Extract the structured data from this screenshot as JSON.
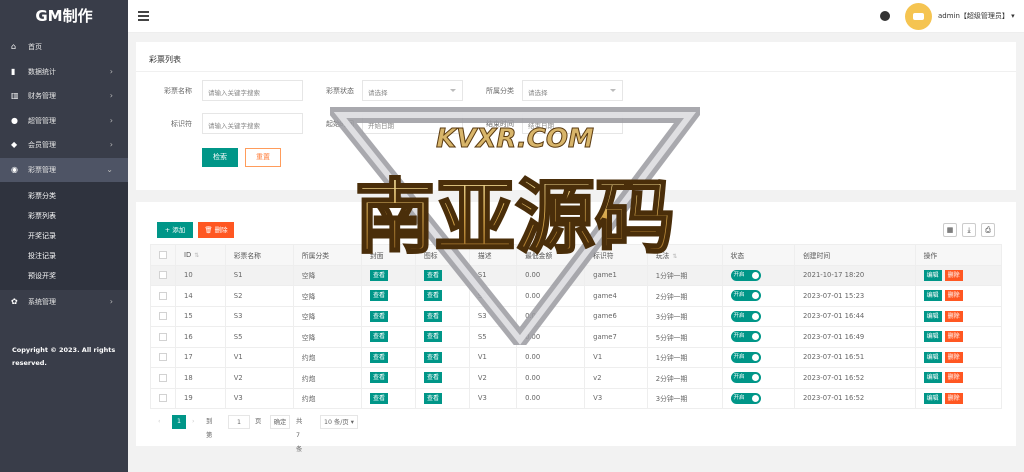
{
  "app": {
    "logo": "GM制作"
  },
  "sidebar": {
    "items": [
      {
        "icon": "home-icon",
        "label": "首页",
        "has_arrow": false
      },
      {
        "icon": "bar-chart-icon",
        "label": "数据统计",
        "has_arrow": true
      },
      {
        "icon": "bank-icon",
        "label": "财务管理",
        "has_arrow": true
      },
      {
        "icon": "user-icon",
        "label": "超管管理",
        "has_arrow": true
      },
      {
        "icon": "users-icon",
        "label": "会员管理",
        "has_arrow": true
      },
      {
        "icon": "gamepad-icon",
        "label": "彩票管理",
        "has_arrow": true,
        "expanded": true
      }
    ],
    "sub_items": [
      "彩票分类",
      "彩票列表",
      "开奖记录",
      "投注记录",
      "预设开奖"
    ],
    "system": {
      "icon": "gear-icon",
      "label": "系统管理"
    },
    "copyright": "Copyright © 2023. All rights reserved."
  },
  "header": {
    "user": "admin【超级管理员】"
  },
  "search": {
    "title": "彩票列表",
    "name_label": "彩票名称",
    "name_placeholder": "请输入关键字搜索",
    "status_label": "彩票状态",
    "status_value": "请选择",
    "category_label": "所属分类",
    "category_value": "请选择",
    "tag_label": "标识符",
    "tag_placeholder": "请输入关键字搜索",
    "start_label": "起始时间",
    "start_placeholder": "开始日期",
    "end_label": "结束时间",
    "end_placeholder": "结束日期",
    "search_btn": "检索",
    "reset_btn": "重置"
  },
  "table": {
    "add_btn": "+ 添加",
    "del_btn": "删除",
    "columns": [
      "ID",
      "彩票名称",
      "所属分类",
      "封面",
      "图标",
      "描述",
      "最低金额",
      "标识符",
      "玩法",
      "状态",
      "创建时间",
      "操作"
    ],
    "view_label": "查看",
    "switch_label": "开启",
    "edit_label": "编辑",
    "delete_label": "删除",
    "rows": [
      {
        "id": "10",
        "name": "S1",
        "cat": "空降",
        "desc": "S1",
        "min": "0.00",
        "tag": "game1",
        "play": "1分钟一期",
        "created": "2021-10-17 18:20"
      },
      {
        "id": "14",
        "name": "S2",
        "cat": "空降",
        "desc": "S2",
        "min": "0.00",
        "tag": "game4",
        "play": "2分钟一期",
        "created": "2023-07-01 15:23"
      },
      {
        "id": "15",
        "name": "S3",
        "cat": "空降",
        "desc": "S3",
        "min": "0.00",
        "tag": "game6",
        "play": "3分钟一期",
        "created": "2023-07-01 16:44"
      },
      {
        "id": "16",
        "name": "S5",
        "cat": "空降",
        "desc": "S5",
        "min": "0.00",
        "tag": "game7",
        "play": "5分钟一期",
        "created": "2023-07-01 16:49"
      },
      {
        "id": "17",
        "name": "V1",
        "cat": "约炮",
        "desc": "V1",
        "min": "0.00",
        "tag": "V1",
        "play": "1分钟一期",
        "created": "2023-07-01 16:51"
      },
      {
        "id": "18",
        "name": "V2",
        "cat": "约炮",
        "desc": "V2",
        "min": "0.00",
        "tag": "v2",
        "play": "2分钟一期",
        "created": "2023-07-01 16:52"
      },
      {
        "id": "19",
        "name": "V3",
        "cat": "约炮",
        "desc": "V3",
        "min": "0.00",
        "tag": "V3",
        "play": "3分钟一期",
        "created": "2023-07-01 16:52"
      }
    ]
  },
  "pager": {
    "current": "1",
    "goto": "到第",
    "page_value": "1",
    "page_unit": "页",
    "confirm": "确定",
    "total": "共 7 条",
    "size": "10 条/页"
  },
  "watermark": {
    "top": "KVXR.COM",
    "main": "南亚源码"
  }
}
